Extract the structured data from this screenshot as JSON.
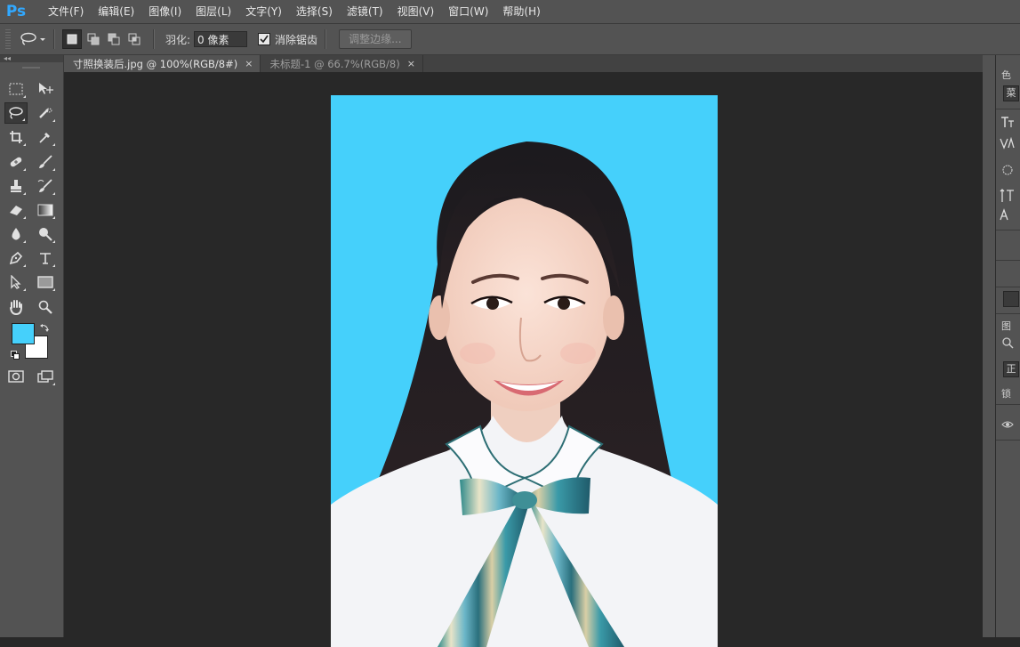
{
  "app": {
    "logo": "Ps",
    "accent_color": "#31a8ff"
  },
  "menu": [
    "文件(F)",
    "编辑(E)",
    "图像(I)",
    "图层(L)",
    "文字(Y)",
    "选择(S)",
    "滤镜(T)",
    "视图(V)",
    "窗口(W)",
    "帮助(H)"
  ],
  "options": {
    "tool_icon": "lasso-icon",
    "feather_label": "羽化:",
    "feather_value": "0 像素",
    "antialias_label": "消除锯齿",
    "antialias_checked": true,
    "refine_edge_label": "调整边缘..."
  },
  "tabs": [
    {
      "label": "寸照换装后.jpg @ 100%(RGB/8#)",
      "close": "×",
      "active": true
    },
    {
      "label": "未标题-1 @ 66.7%(RGB/8)",
      "close": "×",
      "active": false
    }
  ],
  "colors": {
    "foreground": "#45d0fb",
    "background": "#ffffff",
    "photo_background": "#45d0fb"
  },
  "tools": [
    [
      "rect-marquee-icon",
      "move-icon"
    ],
    [
      "lasso-icon",
      "quick-select-icon"
    ],
    [
      "crop-icon",
      "eyedropper-icon"
    ],
    [
      "healing-brush-icon",
      "brush-icon"
    ],
    [
      "clone-stamp-icon",
      "history-brush-icon"
    ],
    [
      "eraser-icon",
      "gradient-icon"
    ],
    [
      "blur-icon",
      "dodge-icon"
    ],
    [
      "pen-icon",
      "type-icon"
    ],
    [
      "path-select-icon",
      "rectangle-shape-icon"
    ],
    [
      "hand-icon",
      "zoom-icon"
    ]
  ],
  "right_panel": {
    "labels": [
      "色",
      "菜",
      "图",
      "正",
      "锁"
    ],
    "icons": [
      "character-icon",
      "kerning-icon",
      "leading-icon",
      "baseline-icon",
      "search-icon",
      "eye-icon"
    ]
  }
}
